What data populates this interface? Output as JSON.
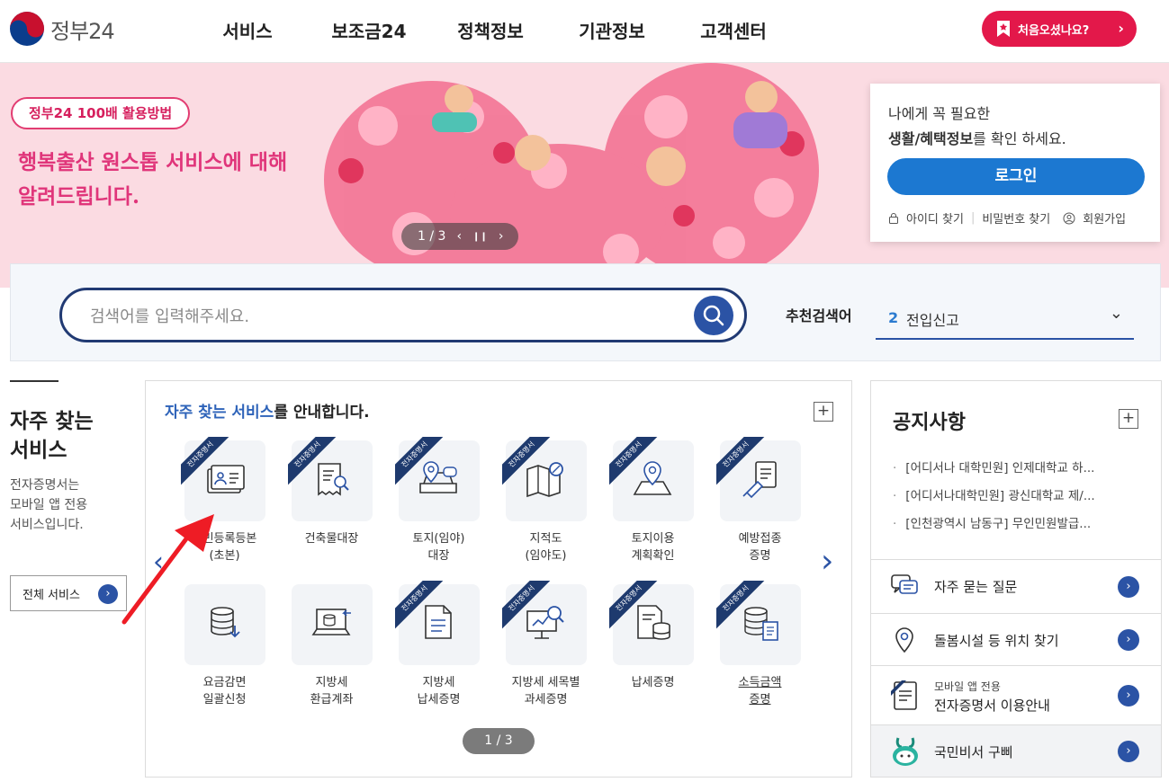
{
  "header": {
    "logo_text": "정부24",
    "nav": [
      "서비스",
      "보조금24",
      "정책정보",
      "기관정보",
      "고객센터"
    ],
    "first_visit_label": "처음오셨나요?"
  },
  "banner": {
    "badge": "정부24 100배 활용방법",
    "title_line1": "행복출산 원스톱 서비스에 대해",
    "title_line2": "알려드립니다.",
    "pager": "1 / 3"
  },
  "login": {
    "line1": "나에게 꼭 필요한",
    "line2_bold": "생활/혜택정보",
    "line2_rest": "를 확인 하세요.",
    "button": "로그인",
    "find_id": "아이디 찾기",
    "find_pw": "비밀번호 찾기",
    "signup": "회원가입"
  },
  "search": {
    "placeholder": "검색어를 입력해주세요.",
    "recommend_label": "추천검색어",
    "recommend_num": "2",
    "recommend_text": "전입신고"
  },
  "frequent": {
    "side_title_1": "자주 찾는",
    "side_title_2": "서비스",
    "side_desc": [
      "전자증명서는",
      "모바일 앱 전용",
      "서비스입니다."
    ],
    "all_button": "전체 서비스",
    "head_highlight": "자주 찾는 서비스",
    "head_rest": "를 안내합니다.",
    "ribbon_text": "전자증명서",
    "pager": "1 / 3",
    "tiles": [
      {
        "l1": "주민등록등본",
        "l2": "(초본)",
        "ribbon": true,
        "icon": "id-card-icon"
      },
      {
        "l1": "건축물대장",
        "l2": "",
        "ribbon": true,
        "icon": "document-search-icon"
      },
      {
        "l1": "토지(임야)",
        "l2": "대장",
        "ribbon": true,
        "icon": "land-location-icon"
      },
      {
        "l1": "지적도",
        "l2": "(임야도)",
        "ribbon": true,
        "icon": "map-search-icon"
      },
      {
        "l1": "토지이용",
        "l2": "계획확인",
        "ribbon": true,
        "icon": "map-pin-icon"
      },
      {
        "l1": "예방접종",
        "l2": "증명",
        "ribbon": true,
        "icon": "vaccine-icon"
      },
      {
        "l1": "요금감면",
        "l2": "일괄신청",
        "ribbon": false,
        "icon": "database-download-icon"
      },
      {
        "l1": "지방세",
        "l2": "환급계좌",
        "ribbon": false,
        "icon": "laptop-refund-icon"
      },
      {
        "l1": "지방세",
        "l2": "납세증명",
        "ribbon": true,
        "icon": "tax-document-icon"
      },
      {
        "l1": "지방세 세목별",
        "l2": "과세증명",
        "ribbon": true,
        "icon": "chart-search-icon"
      },
      {
        "l1": "납세증명",
        "l2": "",
        "ribbon": true,
        "icon": "document-coins-icon"
      },
      {
        "l1": "소득금액",
        "l2": "증명",
        "ribbon": true,
        "icon": "income-document-icon"
      }
    ]
  },
  "notice": {
    "title": "공지사항",
    "items": [
      "[어디서나 대학민원] 인제대학교 하...",
      "[어디서나대학민원] 광신대학교 제/...",
      "[인천광역시 남동구] 무인민원발급..."
    ]
  },
  "quick_links": [
    {
      "label": "자주 묻는 질문",
      "icon": "chat-bubbles-icon"
    },
    {
      "label": "돌봄시설 등 위치 찾기",
      "icon": "location-pin-icon"
    },
    {
      "label_small": "모바일 앱 전용",
      "label": "전자증명서 이용안내",
      "icon": "e-certificate-icon"
    },
    {
      "label": "국민비서 구삐",
      "icon": "gubbi-mascot-icon"
    }
  ]
}
